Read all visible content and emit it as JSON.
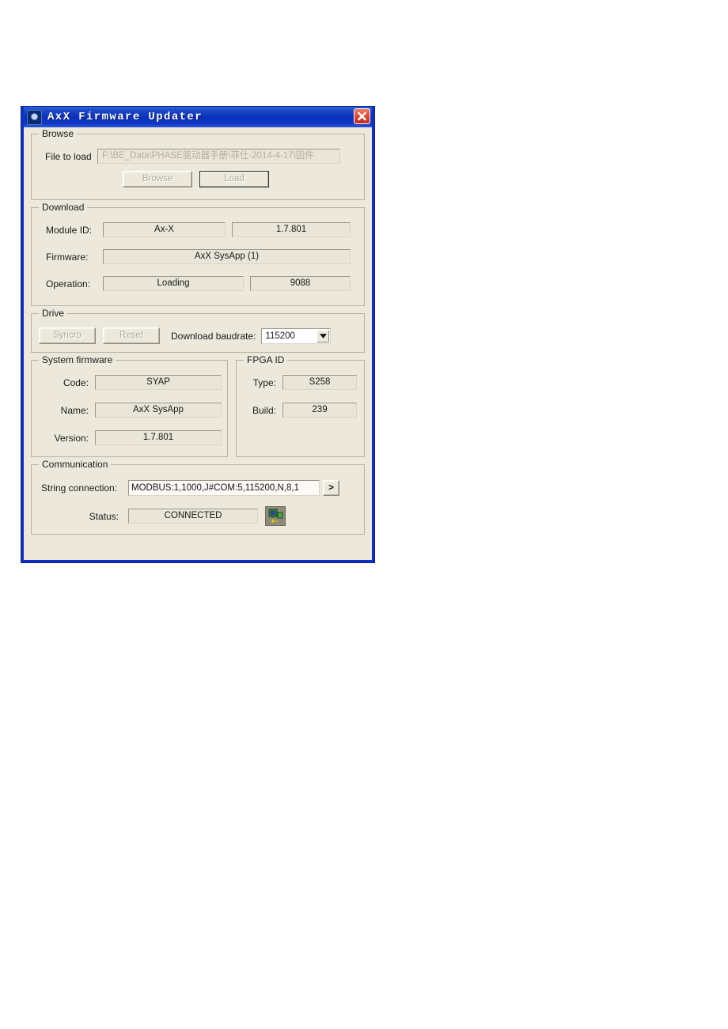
{
  "window": {
    "title": "AxX Firmware Updater",
    "icon": "app-gear-icon",
    "close_label": "✕",
    "frame_color": "#1031c0",
    "client_color": "#ece9dc"
  },
  "browse": {
    "title": "Browse",
    "file_label": "File to load",
    "file_value": "F:\\BE_Data\\PHASE驱动器手册\\菲仕-2014-4-17\\固件",
    "browse_button": "Browse",
    "load_button": "Load"
  },
  "download": {
    "title": "Download",
    "module_id_label": "Module ID:",
    "module_id_value": "Ax-X",
    "module_version_value": "1.7.801",
    "firmware_label": "Firmware:",
    "firmware_value": "AxX SysApp (1)",
    "operation_label": "Operation:",
    "operation_value": "Loading",
    "operation_count": "9088"
  },
  "drive": {
    "title": "Drive",
    "syncro_button": "Syncro",
    "reset_button": "Reset",
    "baudrate_label": "Download baudrate:",
    "baudrate_value": "115200",
    "baudrate_options": [
      "115200"
    ]
  },
  "system_firmware": {
    "title": "System firmware",
    "code_label": "Code:",
    "code_value": "SYAP",
    "name_label": "Name:",
    "name_value": "AxX SysApp",
    "version_label": "Version:",
    "version_value": "1.7.801"
  },
  "fpga_id": {
    "title": "FPGA ID",
    "type_label": "Type:",
    "type_value": "S258",
    "build_label": "Build:",
    "build_value": "239"
  },
  "communication": {
    "title": "Communication",
    "string_label": "String connection:",
    "string_value": "MODBUS:1,1000,J#COM:5,115200,N,8,1",
    "expand_button": ">",
    "status_label": "Status:",
    "status_value": "CONNECTED",
    "connection_icon": "network-connection-icon"
  }
}
